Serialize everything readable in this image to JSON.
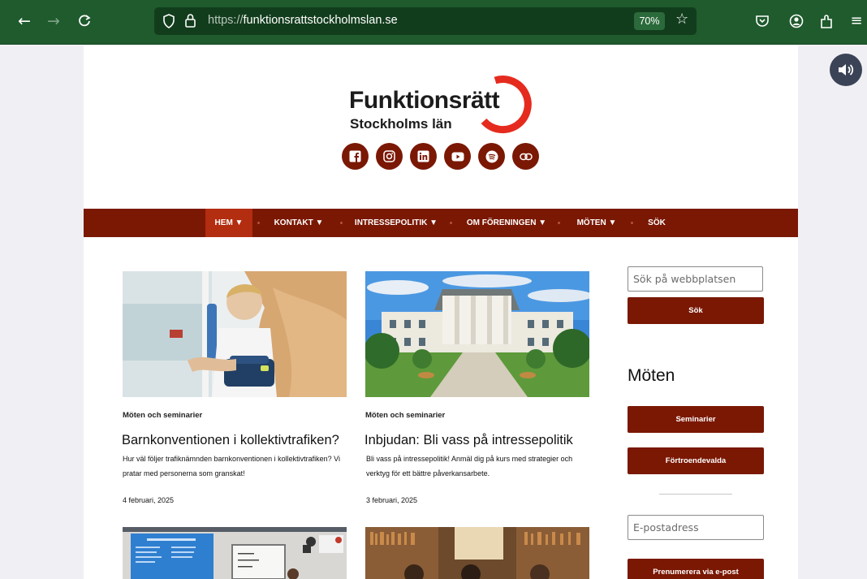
{
  "browser": {
    "url_scheme": "https://",
    "url_host": "funktionsrattstockholmslan.se",
    "zoom": "70%"
  },
  "site": {
    "logo_title": "Funktionsrätt",
    "logo_subtitle": "Stockholms län",
    "brand_color": "#7a1804",
    "accent_color": "#e52b1e",
    "socials": [
      {
        "icon": "facebook-icon"
      },
      {
        "icon": "instagram-icon"
      },
      {
        "icon": "linkedin-icon"
      },
      {
        "icon": "youtube-icon"
      },
      {
        "icon": "spotify-icon"
      },
      {
        "icon": "link-icon"
      }
    ]
  },
  "nav": {
    "items": [
      {
        "label": "HEM ▼",
        "active": true
      },
      {
        "label": "KONTAKT ▼"
      },
      {
        "label": "INTRESSEPOLITIK ▼"
      },
      {
        "label": "OM FÖRENINGEN ▼"
      },
      {
        "label": "MÖTEN ▼"
      },
      {
        "label": "SÖK"
      }
    ]
  },
  "posts": [
    {
      "category": "Möten och seminarier",
      "title": "Barnkonventionen i kollektivtrafiken?",
      "excerpt": "Hur väl följer trafiknämnden barnkonventionen i kollektivtrafiken? Vi pratar med personerna som granskat!",
      "date": "4 februari, 2025"
    },
    {
      "category": "Möten och seminarier",
      "title": "Inbjudan: Bli vass på intressepolitik",
      "excerpt": "Bli vass på intressepolitik! Anmäl dig på kurs med strategier och verktyg för ett bättre påverkansarbete.",
      "date": "3 februari, 2025"
    }
  ],
  "sidebar": {
    "search_placeholder": "Sök på webbplatsen",
    "search_button": "Sök",
    "heading": "Möten",
    "buttons": [
      "Seminarier",
      "Förtroendevalda"
    ],
    "email_placeholder": "E-postadress",
    "subscribe_button": "Prenumerera via e-post"
  }
}
